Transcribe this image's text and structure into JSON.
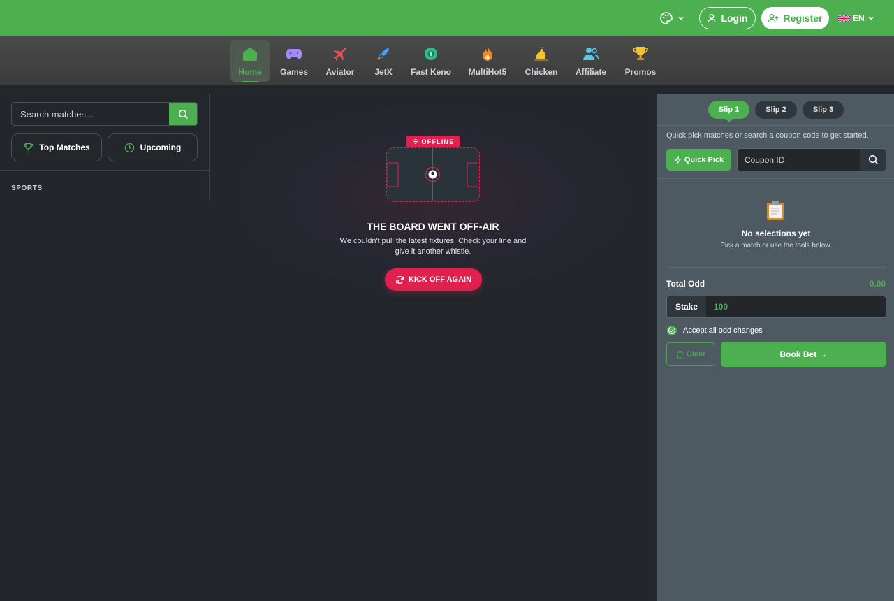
{
  "header": {
    "login_label": "Login",
    "register_label": "Register",
    "language": "EN",
    "brand_color": "#4caf50"
  },
  "nav": {
    "items": [
      {
        "label": "Home",
        "icon": "home-icon",
        "active": true
      },
      {
        "label": "Games",
        "icon": "gamepad-icon"
      },
      {
        "label": "Aviator",
        "icon": "plane-icon"
      },
      {
        "label": "JetX",
        "icon": "rocket-icon"
      },
      {
        "label": "Fast Keno",
        "icon": "keno-ball-icon"
      },
      {
        "label": "MultiHot5",
        "icon": "flame-icon"
      },
      {
        "label": "Chicken",
        "icon": "chicken-icon"
      },
      {
        "label": "Affiliate",
        "icon": "users-icon"
      },
      {
        "label": "Promos",
        "icon": "trophy-icon"
      }
    ]
  },
  "sidebar": {
    "search_placeholder": "Search matches...",
    "top_matches_label": "Top Matches",
    "upcoming_label": "Upcoming",
    "sports_title": "SPORTS"
  },
  "offline": {
    "badge": "OFFLINE",
    "title": "THE BOARD WENT OFF-AIR",
    "text": "We couldn't pull the latest fixtures. Check your line and give it another whistle.",
    "retry_label": "KICK OFF AGAIN",
    "accent_color": "#e0204f"
  },
  "betslip": {
    "tabs": [
      "Slip 1",
      "Slip 2",
      "Slip 3"
    ],
    "active_tab": "Slip 1",
    "hint": "Quick pick matches or search a coupon code to get started.",
    "quick_pick_label": "Quick Pick",
    "coupon_placeholder": "Coupon ID",
    "empty_title": "No selections yet",
    "empty_sub": "Pick a match or use the tools below.",
    "total_odd_label": "Total Odd",
    "total_odd_value": "0.00",
    "stake_label": "Stake",
    "stake_value": "100",
    "accept_label": "Accept all odd changes",
    "clear_label": "Clear",
    "book_bet_label": "Book Bet →"
  }
}
